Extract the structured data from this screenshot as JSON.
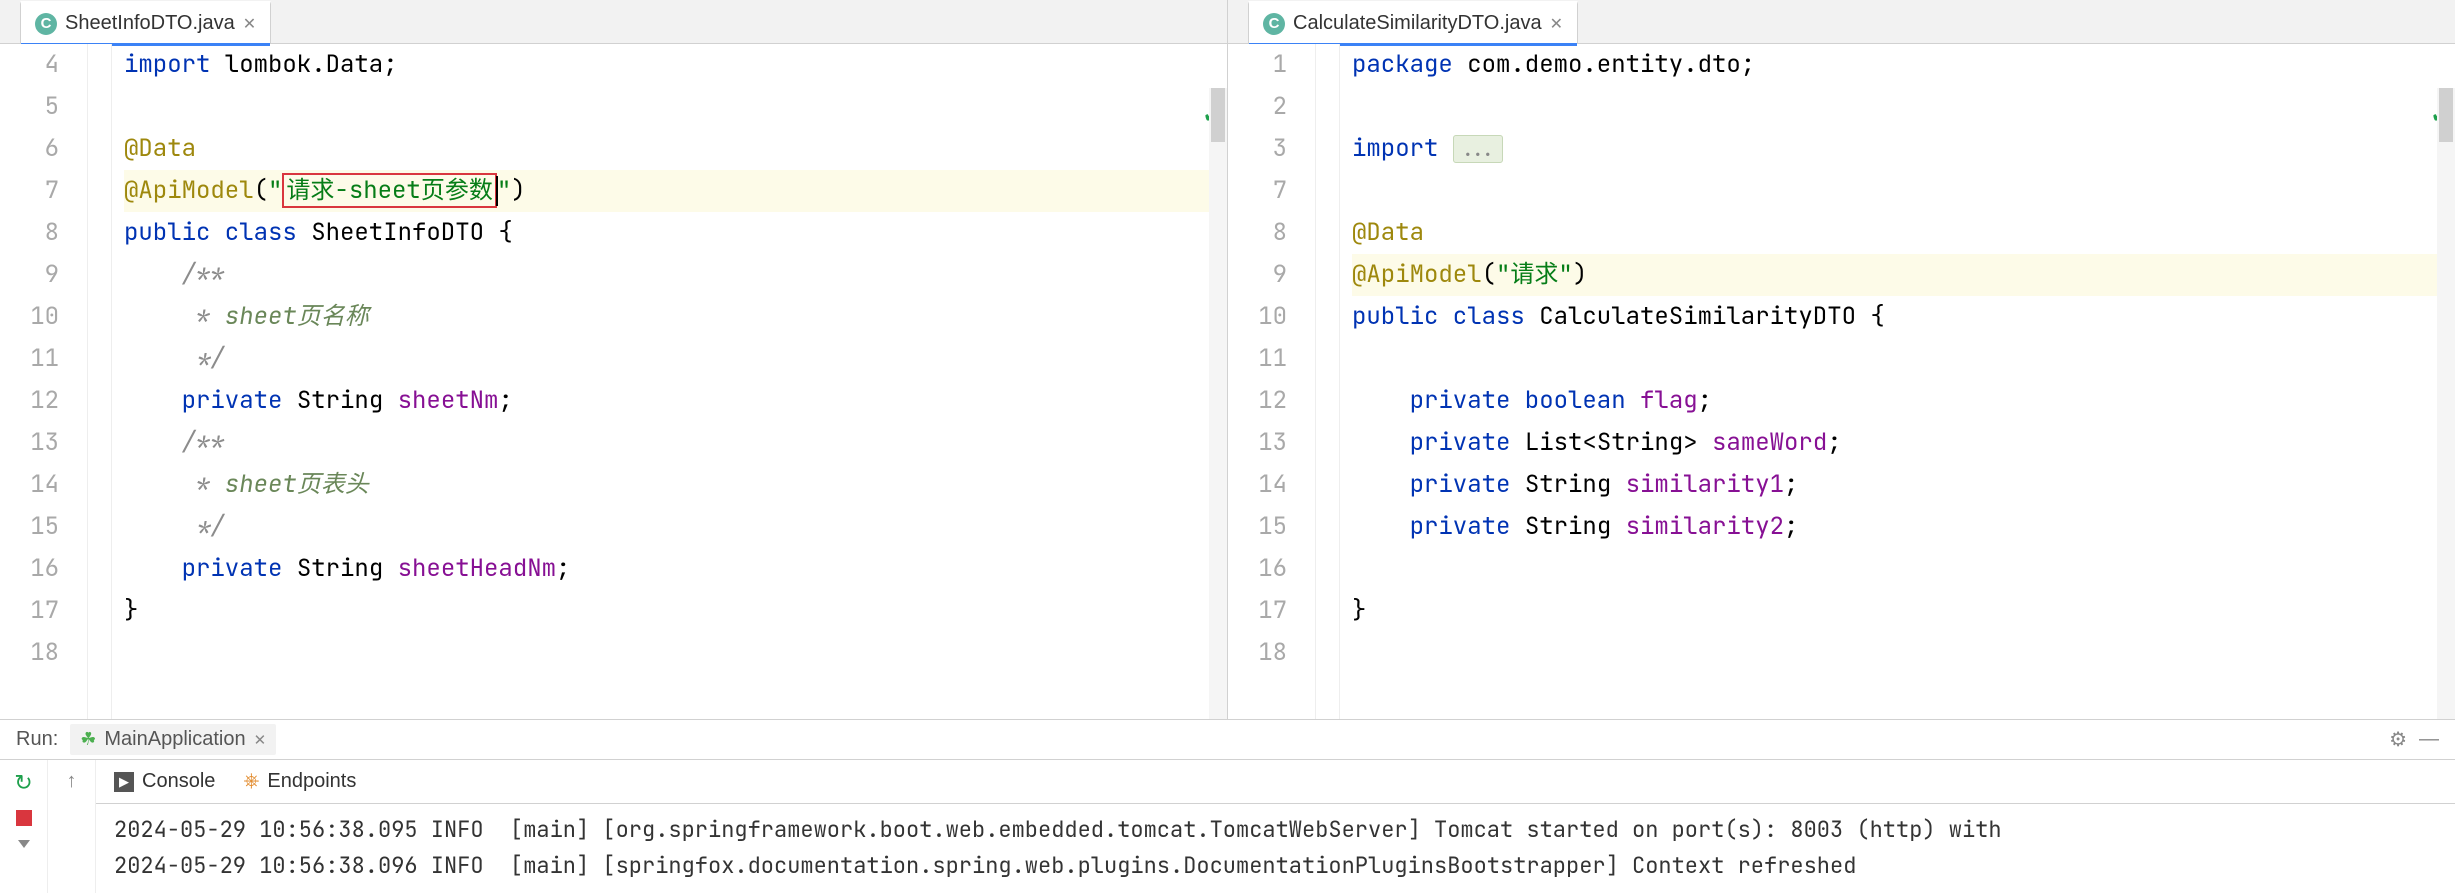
{
  "left": {
    "tab_label": "SheetInfoDTO.java",
    "file_icon_letter": "C",
    "lines": [
      {
        "n": 4,
        "tokens": [
          [
            "kw",
            "import"
          ],
          [
            "pkg",
            " lombok.Data;"
          ]
        ]
      },
      {
        "n": 5,
        "tokens": []
      },
      {
        "n": 6,
        "tokens": [
          [
            "ann",
            "@Data"
          ]
        ]
      },
      {
        "n": 7,
        "hl": true,
        "tokens": [
          [
            "ann",
            "@ApiModel"
          ],
          [
            "pkg",
            "("
          ],
          [
            "str",
            "\""
          ],
          [
            "str redbox",
            "请求-sheet页参数"
          ],
          [
            "caret",
            ""
          ],
          [
            "str",
            "\""
          ],
          [
            "pkg",
            ")"
          ]
        ]
      },
      {
        "n": 8,
        "tokens": [
          [
            "kw",
            "public class"
          ],
          [
            "typ",
            " SheetInfoDTO {"
          ]
        ]
      },
      {
        "n": 9,
        "indent": 1,
        "tokens": [
          [
            "cmt",
            "/**"
          ]
        ]
      },
      {
        "n": 10,
        "indent": 1,
        "tokens": [
          [
            "cmt",
            " * "
          ],
          [
            "cmt-it",
            "sheet页名称"
          ]
        ]
      },
      {
        "n": 11,
        "indent": 1,
        "tokens": [
          [
            "cmt",
            " */"
          ]
        ]
      },
      {
        "n": 12,
        "indent": 1,
        "tokens": [
          [
            "kw",
            "private"
          ],
          [
            "typ",
            " String "
          ],
          [
            "fld",
            "sheetNm"
          ],
          [
            "pkg",
            ";"
          ]
        ]
      },
      {
        "n": 13,
        "indent": 1,
        "tokens": [
          [
            "cmt",
            "/**"
          ]
        ]
      },
      {
        "n": 14,
        "indent": 1,
        "tokens": [
          [
            "cmt",
            " * "
          ],
          [
            "cmt-it",
            "sheet页表头"
          ]
        ]
      },
      {
        "n": 15,
        "indent": 1,
        "tokens": [
          [
            "cmt",
            " */"
          ]
        ]
      },
      {
        "n": 16,
        "indent": 1,
        "tokens": [
          [
            "kw",
            "private"
          ],
          [
            "typ",
            " String "
          ],
          [
            "fld",
            "sheetHeadNm"
          ],
          [
            "pkg",
            ";"
          ]
        ]
      },
      {
        "n": 17,
        "tokens": [
          [
            "pkg",
            "}"
          ]
        ]
      },
      {
        "n": 18,
        "tokens": []
      }
    ]
  },
  "right": {
    "tab_label": "CalculateSimilarityDTO.java",
    "file_icon_letter": "C",
    "lines": [
      {
        "n": 1,
        "tokens": [
          [
            "kw",
            "package"
          ],
          [
            "pkg",
            " com.demo.entity.dto;"
          ]
        ]
      },
      {
        "n": 2,
        "tokens": []
      },
      {
        "n": 3,
        "tokens": [
          [
            "kw",
            "import "
          ],
          [
            "fold",
            "..."
          ]
        ]
      },
      {
        "n": 7,
        "tokens": []
      },
      {
        "n": 8,
        "tokens": [
          [
            "ann",
            "@Data"
          ]
        ]
      },
      {
        "n": 9,
        "hl": true,
        "tokens": [
          [
            "ann",
            "@ApiModel"
          ],
          [
            "pkg",
            "("
          ],
          [
            "str",
            "\"请求\""
          ],
          [
            "pkg",
            ")"
          ]
        ]
      },
      {
        "n": 10,
        "tokens": [
          [
            "kw",
            "public class"
          ],
          [
            "typ",
            " CalculateSimilarityDTO {"
          ]
        ]
      },
      {
        "n": 11,
        "tokens": []
      },
      {
        "n": 12,
        "indent": 1,
        "tokens": [
          [
            "kw",
            "private boolean"
          ],
          [
            "typ",
            " "
          ],
          [
            "fld",
            "flag"
          ],
          [
            "pkg",
            ";"
          ]
        ]
      },
      {
        "n": 13,
        "indent": 1,
        "tokens": [
          [
            "kw",
            "private"
          ],
          [
            "typ",
            " List<String> "
          ],
          [
            "fld",
            "sameWord"
          ],
          [
            "pkg",
            ";"
          ]
        ]
      },
      {
        "n": 14,
        "indent": 1,
        "tokens": [
          [
            "kw",
            "private"
          ],
          [
            "typ",
            " String "
          ],
          [
            "fld",
            "similarity1"
          ],
          [
            "pkg",
            ";"
          ]
        ]
      },
      {
        "n": 15,
        "indent": 1,
        "tokens": [
          [
            "kw",
            "private"
          ],
          [
            "typ",
            " String "
          ],
          [
            "fld",
            "similarity2"
          ],
          [
            "pkg",
            ";"
          ]
        ]
      },
      {
        "n": 16,
        "tokens": []
      },
      {
        "n": 17,
        "tokens": [
          [
            "pkg",
            "}"
          ]
        ]
      },
      {
        "n": 18,
        "tokens": []
      }
    ]
  },
  "run": {
    "title": "Run:",
    "config_name": "MainApplication",
    "tabs": {
      "console": "Console",
      "endpoints": "Endpoints"
    },
    "output": [
      "2024-05-29 10:56:38.095 INFO  [main] [org.springframework.boot.web.embedded.tomcat.TomcatWebServer] Tomcat started on port(s): 8003 (http) with",
      "2024-05-29 10:56:38.096 INFO  [main] [springfox.documentation.spring.web.plugins.DocumentationPluginsBootstrapper] Context refreshed"
    ]
  }
}
